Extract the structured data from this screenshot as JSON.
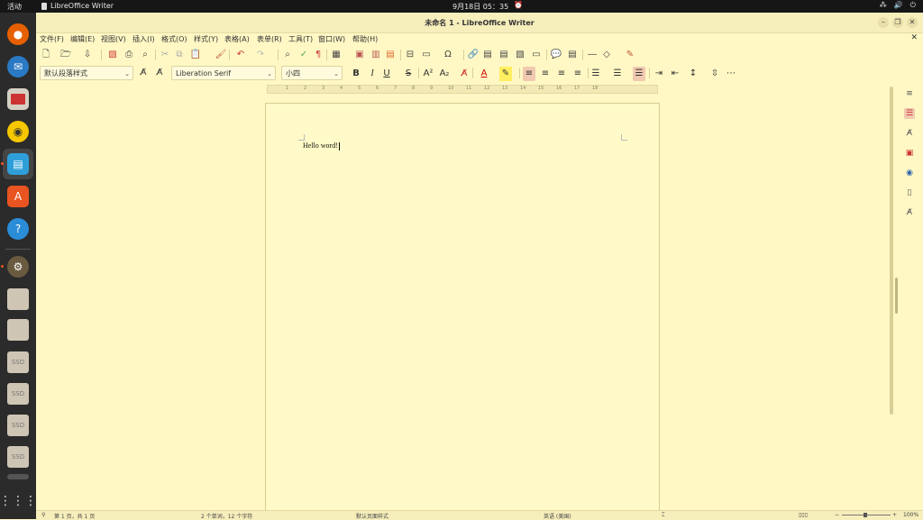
{
  "topbar": {
    "activities": "活动",
    "app_name": "LibreOffice Writer",
    "clock": "9月18日  05：35"
  },
  "window": {
    "title": "未命名 1 - LibreOffice Writer"
  },
  "menu": [
    "文件(F)",
    "编辑(E)",
    "视图(V)",
    "插入(I)",
    "格式(O)",
    "样式(Y)",
    "表格(A)",
    "表单(R)",
    "工具(T)",
    "窗口(W)",
    "帮助(H)"
  ],
  "formatting": {
    "paragraph_style": "默认段落样式",
    "font_name": "Liberation Serif",
    "font_size": "小四",
    "bold": "B",
    "italic": "I",
    "underline": "U",
    "strike": "S"
  },
  "ruler": {
    "ticks": [
      "1",
      "2",
      "3",
      "4",
      "5",
      "6",
      "7",
      "8",
      "9",
      "10",
      "11",
      "12",
      "13",
      "14",
      "15",
      "16",
      "17",
      "18"
    ]
  },
  "document": {
    "text": "Hello word!"
  },
  "statusbar": {
    "page": "第 1 页，共 1 页",
    "words": "2 个单词，12 个字符",
    "page_style": "默认页面样式",
    "language": "英语 (美国)",
    "zoom": "100%"
  },
  "colors": {
    "accent": "#e95420",
    "page_bg": "#fffac7",
    "chrome_bg": "#f6eebb"
  }
}
